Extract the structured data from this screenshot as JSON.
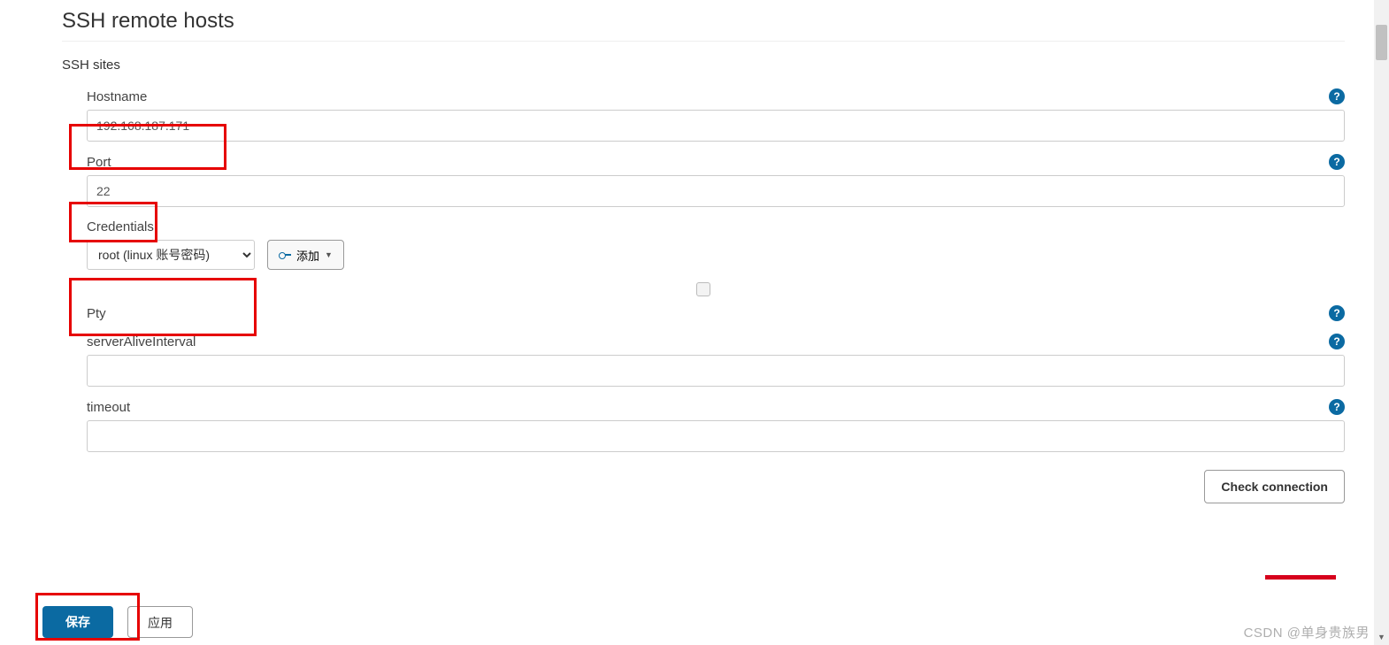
{
  "title": "SSH remote hosts",
  "section_label": "SSH sites",
  "fields": {
    "hostname": {
      "label": "Hostname",
      "value": "192.168.187.171"
    },
    "port": {
      "label": "Port",
      "value": "22"
    },
    "credentials": {
      "label": "Credentials",
      "selected": "root (linux 账号密码)",
      "add_label": "添加"
    },
    "pty": {
      "label": "Pty"
    },
    "serverAliveInterval": {
      "label": "serverAliveInterval",
      "value": ""
    },
    "timeout": {
      "label": "timeout",
      "value": ""
    }
  },
  "buttons": {
    "check_connection": "Check connection",
    "save": "保存",
    "apply": "应用"
  },
  "help_glyph": "?",
  "watermark": "CSDN @单身贵族男"
}
